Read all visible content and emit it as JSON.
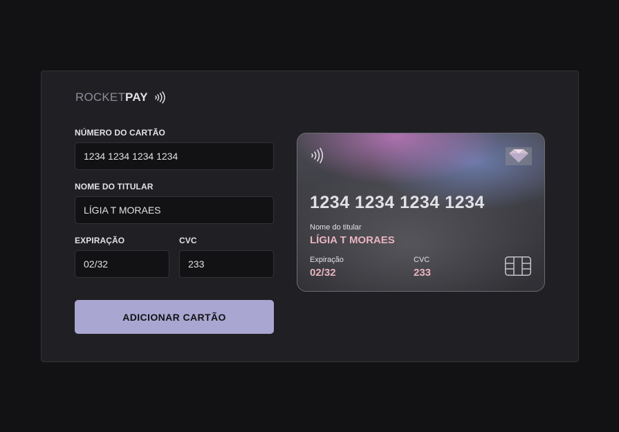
{
  "logo": {
    "part1": "ROCKET",
    "part2": "PAY",
    "icon": "nfc-contactless-icon"
  },
  "form": {
    "number_label": "NÚMERO DO CARTÃO",
    "number_value": "1234 1234 1234 1234",
    "holder_label": "NOME DO TITULAR",
    "holder_value": "LÍGIA T MORAES",
    "expiry_label": "EXPIRAÇÃO",
    "expiry_value": "02/32",
    "cvc_label": "CVC",
    "cvc_value": "233",
    "submit_label": "ADICIONAR CARTÃO"
  },
  "card": {
    "number": "1234 1234 1234 1234",
    "holder_label": "Nome do titular",
    "holder_value": "LÍGIA T MORAES",
    "expiry_label": "Expiração",
    "expiry_value": "02/32",
    "cvc_label": "CVC",
    "cvc_value": "233",
    "icons": [
      "nfc-contactless-icon",
      "card-brand-gem-icon",
      "chip-icon"
    ]
  },
  "colors": {
    "background": "#121214",
    "panel": "#202024",
    "input_bg": "#121214",
    "accent_button": "#a9a6d2",
    "card_value": "#e9b4bf",
    "text": "#e1e1e6"
  }
}
